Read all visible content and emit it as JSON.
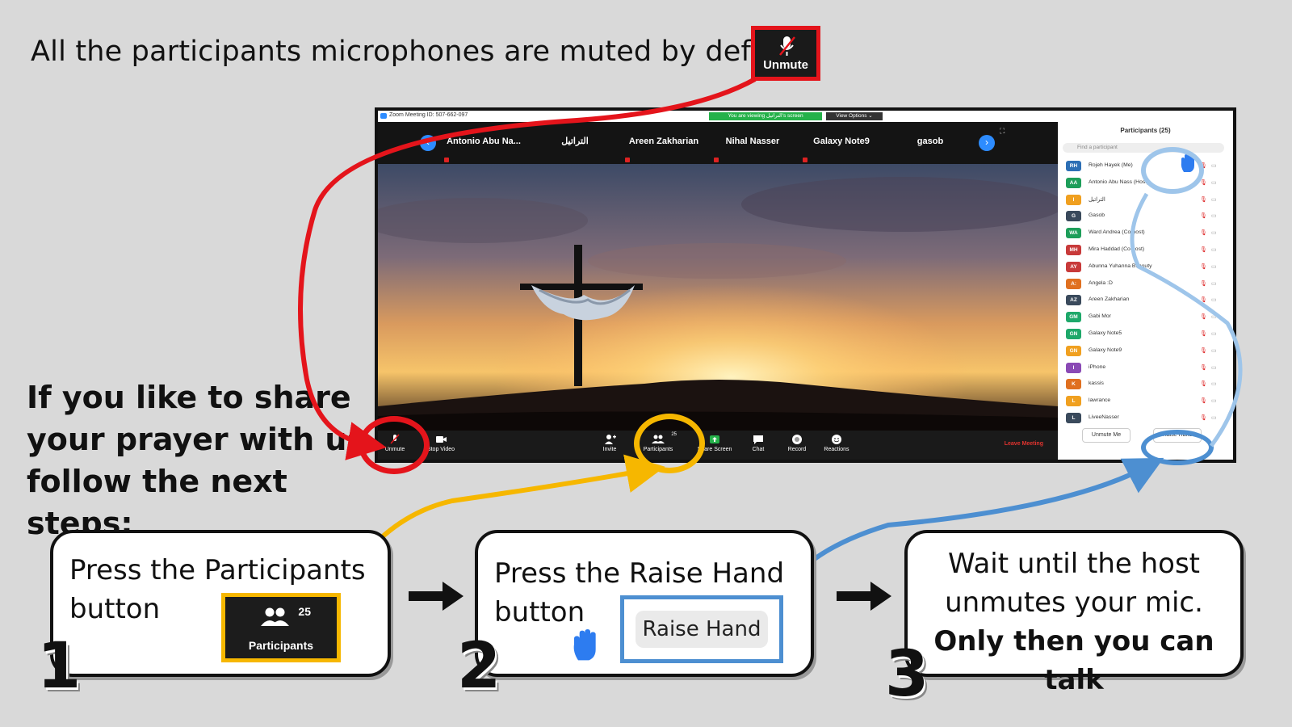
{
  "header": {
    "caption": "All the participants microphones are muted by default",
    "unmute_label": "Unmute"
  },
  "side_text": {
    "lines": [
      "If you like to share",
      "your prayer with us",
      "follow the next steps:"
    ]
  },
  "zoom": {
    "title": "Zoom Meeting ID: 507-662-097",
    "viewing_pill": "You are viewing التراتيل's screen",
    "view_options": "View Options ⌄",
    "name_tiles": [
      "Antonio Abu Na...",
      "التراتيل",
      "Areen Zakharian",
      "Nihal Nasser",
      "Galaxy Note9",
      "gasob"
    ],
    "toolbar": {
      "unmute": "Unmute",
      "stop_video": "Stop Video",
      "invite": "Invite",
      "participants": "Participants",
      "participants_count": "25",
      "share_screen": "Share Screen",
      "chat": "Chat",
      "record": "Record",
      "reactions": "Reactions",
      "leave": "Leave Meeting"
    },
    "panel": {
      "title": "Participants (25)",
      "search_placeholder": "Find a participant",
      "participants": [
        {
          "initials": "RH",
          "name": "Rojeh Hayek (Me)",
          "color": "#2d6fb5"
        },
        {
          "initials": "AA",
          "name": "Antonio Abu Nass (Host)",
          "color": "#1e9e5a"
        },
        {
          "initials": "I",
          "name": "التراتيل",
          "color": "#f0a020"
        },
        {
          "initials": "G",
          "name": "Gasob",
          "color": "#3a4a5c"
        },
        {
          "initials": "WA",
          "name": "Ward Andrea (Co-host)",
          "color": "#1e9e5a"
        },
        {
          "initials": "MH",
          "name": "Mira Haddad (Co-host)",
          "color": "#c83a3a"
        },
        {
          "initials": "AY",
          "name": "Abunna Yuhanna Bshouty",
          "color": "#c83a3a"
        },
        {
          "initials": "A:",
          "name": "Angela :D",
          "color": "#e07020"
        },
        {
          "initials": "AZ",
          "name": "Areen Zakharian",
          "color": "#3a4a5c"
        },
        {
          "initials": "GM",
          "name": "Gabi Mor",
          "color": "#1ea86a"
        },
        {
          "initials": "GN",
          "name": "Galaxy Note5",
          "color": "#1ea86a"
        },
        {
          "initials": "GN",
          "name": "Galaxy Note9",
          "color": "#f0a020"
        },
        {
          "initials": "I",
          "name": "iPhone",
          "color": "#8a4ab5"
        },
        {
          "initials": "K",
          "name": "kassis",
          "color": "#e07020"
        },
        {
          "initials": "L",
          "name": "lawrance",
          "color": "#f0a020"
        },
        {
          "initials": "L",
          "name": "LiveeNasser",
          "color": "#3a4a5c"
        }
      ],
      "unmute_me": "Unmute Me",
      "raise_hand": "Raise Hand"
    }
  },
  "steps": [
    {
      "number": "1",
      "text": "Press the Participants button",
      "callout_label": "Participants",
      "callout_count": "25"
    },
    {
      "number": "2",
      "text": "Press the Raise Hand button",
      "callout_label": "Raise Hand"
    },
    {
      "number": "3",
      "line1": "Wait until the host",
      "line2": "unmutes your mic.",
      "line3": "Only then you can talk"
    }
  ],
  "colors": {
    "red": "#e4141b",
    "yellow": "#f6b700",
    "blue": "#4d8fd1",
    "light_blue": "#9ec5ea"
  }
}
